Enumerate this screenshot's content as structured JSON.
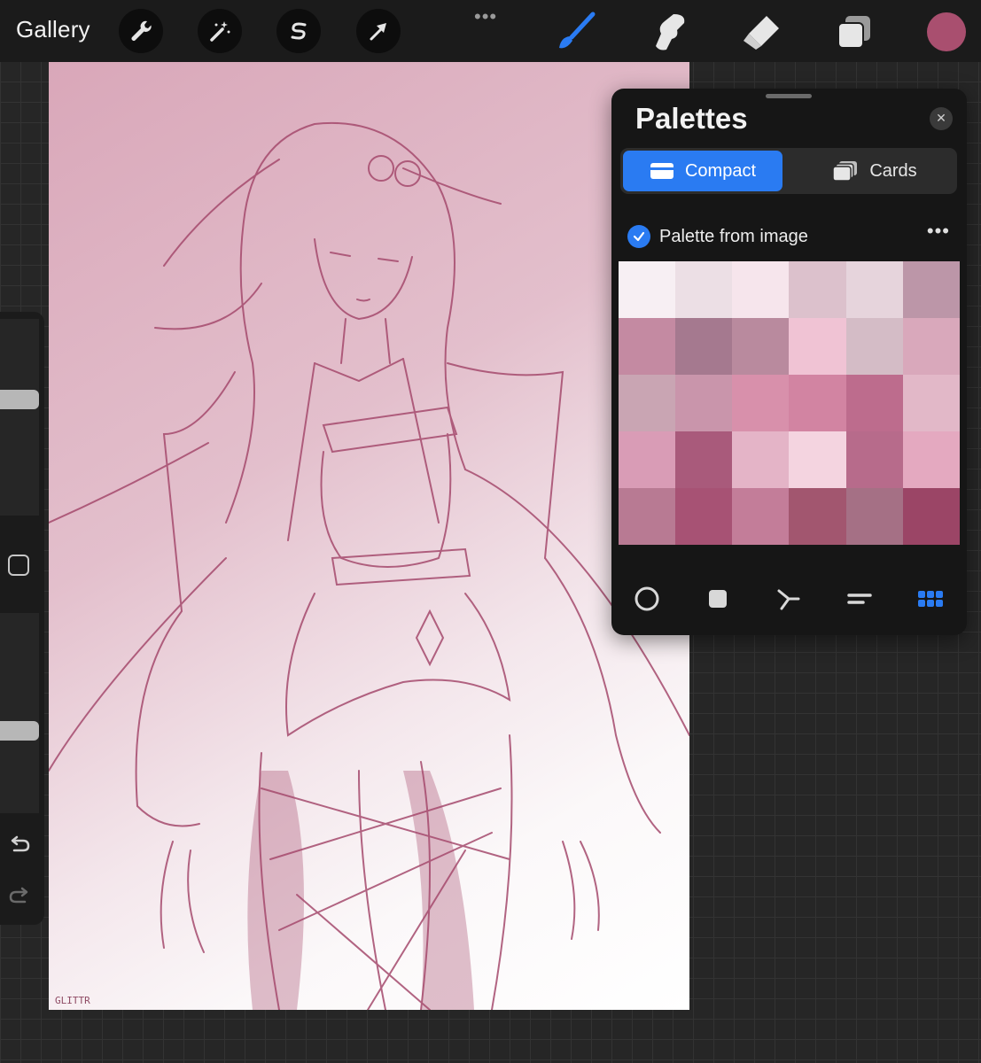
{
  "toolbar": {
    "gallery_label": "Gallery",
    "left_tools": [
      "wrench-icon",
      "magic-wand-icon",
      "selection-s-icon",
      "transform-arrow-icon"
    ],
    "more_label": "•••",
    "right_tools": [
      "brush-icon",
      "smudge-icon",
      "eraser-icon",
      "layers-icon"
    ],
    "active_tool": "brush",
    "active_color": "#a94f6f",
    "accent_color": "#2a7bf2"
  },
  "canvas": {
    "signature": "GLITTR"
  },
  "sidebar": {
    "brush_size": 0.6,
    "brush_opacity": 0.4,
    "icons": [
      "modify-square-icon",
      "undo-icon",
      "redo-icon"
    ]
  },
  "palettes_panel": {
    "title": "Palettes",
    "close_symbol": "✕",
    "tabs": [
      {
        "label": "Compact",
        "active": true,
        "icon": "compact-card-icon"
      },
      {
        "label": "Cards",
        "active": false,
        "icon": "cards-stack-icon"
      }
    ],
    "palette": {
      "name": "Palette from image",
      "selected": true,
      "more_label": "•••",
      "swatches": [
        "#f7eff3",
        "#ecdfe5",
        "#f6e5ec",
        "#dcc1cc",
        "#e6d4dc",
        "#bc96a8",
        "#c48aa2",
        "#a5798f",
        "#b98a9e",
        "#f0c3d4",
        "#d4bcc6",
        "#d9a8bb",
        "#c9a5b3",
        "#c995ab",
        "#d890ab",
        "#d284a2",
        "#bd6c8d",
        "#e2b8c8",
        "#d99cb6",
        "#a95a7b",
        "#e4b4c7",
        "#f4d4e0",
        "#b76b8b",
        "#e4a9c0",
        "#b87a93",
        "#a75274",
        "#c37d99",
        "#a2566f",
        "#a57085",
        "#9b4566"
      ]
    },
    "view_modes": [
      "disc-icon",
      "classic-square-icon",
      "harmony-icon",
      "value-sliders-icon",
      "palettes-grid-icon"
    ],
    "active_view": "palettes-grid-icon"
  }
}
